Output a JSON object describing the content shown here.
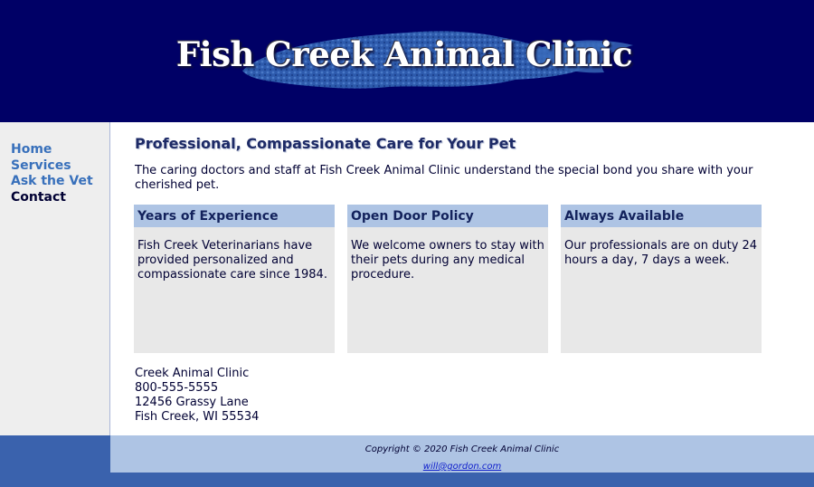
{
  "header": {
    "title": "Fish Creek Animal Clinic",
    "bg_color": "#000066",
    "logo_image": "fish-silhouette-logo"
  },
  "nav": {
    "items": [
      {
        "label": "Home"
      },
      {
        "label": "Services"
      },
      {
        "label": "Ask the Vet"
      },
      {
        "label": "Contact",
        "active": true
      }
    ]
  },
  "main": {
    "heading": "Professional, Compassionate Care for Your Pet",
    "intro": "The caring doctors and staff at Fish Creek Animal Clinic understand the special bond you share with your cherished pet.",
    "boxes": [
      {
        "title": "Years of Experience",
        "text": "Fish Creek Veterinarians have provided personalized and compassionate care since 1984."
      },
      {
        "title": "Open Door Policy",
        "text": "We welcome owners to stay with their pets during any medical procedure."
      },
      {
        "title": "Always Available",
        "text": "Our professionals are on duty 24 hours a day, 7 days a week."
      }
    ],
    "address": {
      "name": "Creek Animal Clinic",
      "phone": "800-555-5555",
      "street": "12456 Grassy Lane",
      "city": "Fish Creek, WI 55534"
    }
  },
  "footer": {
    "copyright": "Copyright © 2020 Fish Creek Animal Clinic",
    "email": "will@gordon.com"
  },
  "colors": {
    "accent_light": "#aec4e4",
    "nav_link": "#3870bb",
    "page_bg": "#3a62ad"
  }
}
